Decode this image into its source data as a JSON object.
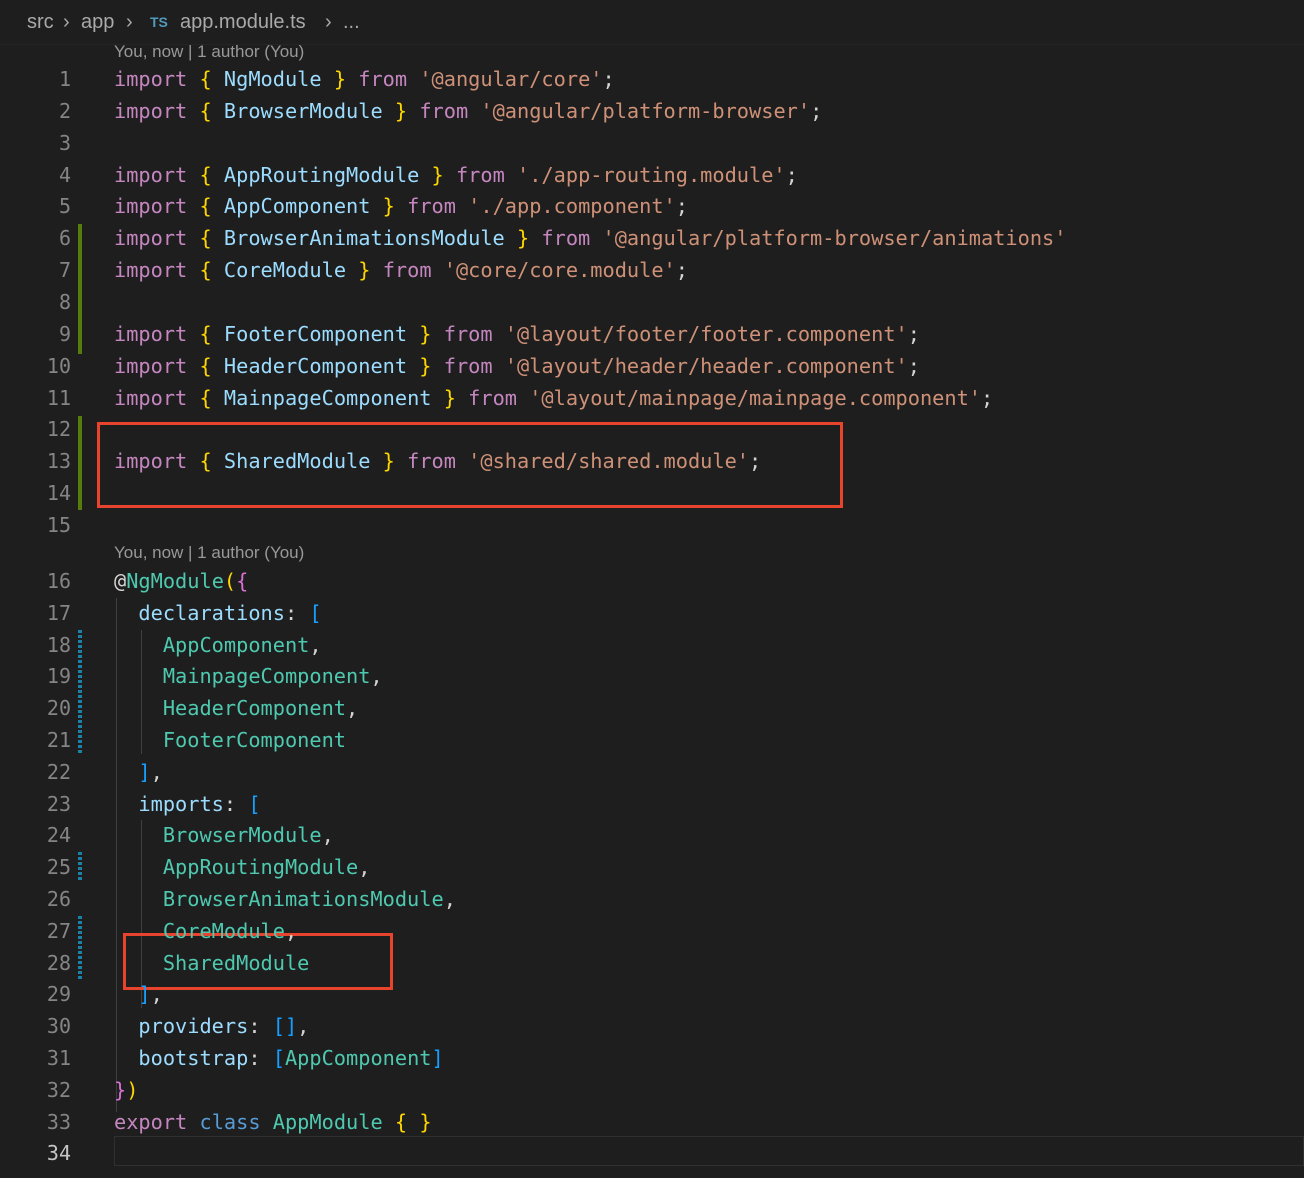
{
  "breadcrumb": {
    "items": [
      "src",
      "app"
    ],
    "file_icon": "TS",
    "file": "app.module.ts",
    "trailing": "..."
  },
  "codelens": {
    "first": "You, now | 1 author (You)",
    "second": "You, now | 1 author (You)"
  },
  "editor": {
    "current_line": 34,
    "lines": [
      {
        "n": 1,
        "tokens": [
          [
            "kw",
            "import"
          ],
          [
            "punc",
            " "
          ],
          [
            "br",
            "{"
          ],
          [
            "punc",
            " "
          ],
          [
            "id",
            "NgModule"
          ],
          [
            "punc",
            " "
          ],
          [
            "br",
            "}"
          ],
          [
            "punc",
            " "
          ],
          [
            "kw",
            "from"
          ],
          [
            "punc",
            " "
          ],
          [
            "str",
            "'@angular/core'"
          ],
          [
            "punc",
            ";"
          ]
        ]
      },
      {
        "n": 2,
        "tokens": [
          [
            "kw",
            "import"
          ],
          [
            "punc",
            " "
          ],
          [
            "br",
            "{"
          ],
          [
            "punc",
            " "
          ],
          [
            "id",
            "BrowserModule"
          ],
          [
            "punc",
            " "
          ],
          [
            "br",
            "}"
          ],
          [
            "punc",
            " "
          ],
          [
            "kw",
            "from"
          ],
          [
            "punc",
            " "
          ],
          [
            "str",
            "'@angular/platform-browser'"
          ],
          [
            "punc",
            ";"
          ]
        ]
      },
      {
        "n": 3,
        "tokens": []
      },
      {
        "n": 4,
        "tokens": [
          [
            "kw",
            "import"
          ],
          [
            "punc",
            " "
          ],
          [
            "br",
            "{"
          ],
          [
            "punc",
            " "
          ],
          [
            "id",
            "AppRoutingModule"
          ],
          [
            "punc",
            " "
          ],
          [
            "br",
            "}"
          ],
          [
            "punc",
            " "
          ],
          [
            "kw",
            "from"
          ],
          [
            "punc",
            " "
          ],
          [
            "str",
            "'./app-routing.module'"
          ],
          [
            "punc",
            ";"
          ]
        ]
      },
      {
        "n": 5,
        "tokens": [
          [
            "kw",
            "import"
          ],
          [
            "punc",
            " "
          ],
          [
            "br",
            "{"
          ],
          [
            "punc",
            " "
          ],
          [
            "id",
            "AppComponent"
          ],
          [
            "punc",
            " "
          ],
          [
            "br",
            "}"
          ],
          [
            "punc",
            " "
          ],
          [
            "kw",
            "from"
          ],
          [
            "punc",
            " "
          ],
          [
            "str",
            "'./app.component'"
          ],
          [
            "punc",
            ";"
          ]
        ]
      },
      {
        "n": 6,
        "tokens": [
          [
            "kw",
            "import"
          ],
          [
            "punc",
            " "
          ],
          [
            "br",
            "{"
          ],
          [
            "punc",
            " "
          ],
          [
            "id",
            "BrowserAnimationsModule"
          ],
          [
            "punc",
            " "
          ],
          [
            "br",
            "}"
          ],
          [
            "punc",
            " "
          ],
          [
            "kw",
            "from"
          ],
          [
            "punc",
            " "
          ],
          [
            "str",
            "'@angular/platform-browser/animations'"
          ]
        ]
      },
      {
        "n": 7,
        "tokens": [
          [
            "kw",
            "import"
          ],
          [
            "punc",
            " "
          ],
          [
            "br",
            "{"
          ],
          [
            "punc",
            " "
          ],
          [
            "id",
            "CoreModule"
          ],
          [
            "punc",
            " "
          ],
          [
            "br",
            "}"
          ],
          [
            "punc",
            " "
          ],
          [
            "kw",
            "from"
          ],
          [
            "punc",
            " "
          ],
          [
            "str",
            "'@core/core.module'"
          ],
          [
            "punc",
            ";"
          ]
        ]
      },
      {
        "n": 8,
        "tokens": []
      },
      {
        "n": 9,
        "tokens": [
          [
            "kw",
            "import"
          ],
          [
            "punc",
            " "
          ],
          [
            "br",
            "{"
          ],
          [
            "punc",
            " "
          ],
          [
            "id",
            "FooterComponent"
          ],
          [
            "punc",
            " "
          ],
          [
            "br",
            "}"
          ],
          [
            "punc",
            " "
          ],
          [
            "kw",
            "from"
          ],
          [
            "punc",
            " "
          ],
          [
            "str",
            "'@layout/footer/footer.component'"
          ],
          [
            "punc",
            ";"
          ]
        ]
      },
      {
        "n": 10,
        "tokens": [
          [
            "kw",
            "import"
          ],
          [
            "punc",
            " "
          ],
          [
            "br",
            "{"
          ],
          [
            "punc",
            " "
          ],
          [
            "id",
            "HeaderComponent"
          ],
          [
            "punc",
            " "
          ],
          [
            "br",
            "}"
          ],
          [
            "punc",
            " "
          ],
          [
            "kw",
            "from"
          ],
          [
            "punc",
            " "
          ],
          [
            "str",
            "'@layout/header/header.component'"
          ],
          [
            "punc",
            ";"
          ]
        ]
      },
      {
        "n": 11,
        "tokens": [
          [
            "kw",
            "import"
          ],
          [
            "punc",
            " "
          ],
          [
            "br",
            "{"
          ],
          [
            "punc",
            " "
          ],
          [
            "id",
            "MainpageComponent"
          ],
          [
            "punc",
            " "
          ],
          [
            "br",
            "}"
          ],
          [
            "punc",
            " "
          ],
          [
            "kw",
            "from"
          ],
          [
            "punc",
            " "
          ],
          [
            "str",
            "'@layout/mainpage/mainpage.component'"
          ],
          [
            "punc",
            ";"
          ]
        ]
      },
      {
        "n": 12,
        "tokens": []
      },
      {
        "n": 13,
        "tokens": [
          [
            "kw",
            "import"
          ],
          [
            "punc",
            " "
          ],
          [
            "br",
            "{"
          ],
          [
            "punc",
            " "
          ],
          [
            "id",
            "SharedModule"
          ],
          [
            "punc",
            " "
          ],
          [
            "br",
            "}"
          ],
          [
            "punc",
            " "
          ],
          [
            "kw",
            "from"
          ],
          [
            "punc",
            " "
          ],
          [
            "str",
            "'@shared/shared.module'"
          ],
          [
            "punc",
            ";"
          ]
        ]
      },
      {
        "n": 14,
        "tokens": []
      },
      {
        "n": 15,
        "tokens": []
      },
      {
        "n": 16,
        "tokens": [
          [
            "punc",
            "@"
          ],
          [
            "cls",
            "NgModule"
          ],
          [
            "br",
            "("
          ],
          [
            "br2",
            "{"
          ]
        ]
      },
      {
        "n": 17,
        "tokens": [
          [
            "punc",
            "  "
          ],
          [
            "id",
            "declarations"
          ],
          [
            "punc",
            ": "
          ],
          [
            "br3",
            "["
          ]
        ]
      },
      {
        "n": 18,
        "tokens": [
          [
            "punc",
            "    "
          ],
          [
            "cls",
            "AppComponent"
          ],
          [
            "punc",
            ","
          ]
        ]
      },
      {
        "n": 19,
        "tokens": [
          [
            "punc",
            "    "
          ],
          [
            "cls",
            "MainpageComponent"
          ],
          [
            "punc",
            ","
          ]
        ]
      },
      {
        "n": 20,
        "tokens": [
          [
            "punc",
            "    "
          ],
          [
            "cls",
            "HeaderComponent"
          ],
          [
            "punc",
            ","
          ]
        ]
      },
      {
        "n": 21,
        "tokens": [
          [
            "punc",
            "    "
          ],
          [
            "cls",
            "FooterComponent"
          ]
        ]
      },
      {
        "n": 22,
        "tokens": [
          [
            "punc",
            "  "
          ],
          [
            "br3",
            "]"
          ],
          [
            "punc",
            ","
          ]
        ]
      },
      {
        "n": 23,
        "tokens": [
          [
            "punc",
            "  "
          ],
          [
            "id",
            "imports"
          ],
          [
            "punc",
            ": "
          ],
          [
            "br3",
            "["
          ]
        ]
      },
      {
        "n": 24,
        "tokens": [
          [
            "punc",
            "    "
          ],
          [
            "cls",
            "BrowserModule"
          ],
          [
            "punc",
            ","
          ]
        ]
      },
      {
        "n": 25,
        "tokens": [
          [
            "punc",
            "    "
          ],
          [
            "cls",
            "AppRoutingModule"
          ],
          [
            "punc",
            ","
          ]
        ]
      },
      {
        "n": 26,
        "tokens": [
          [
            "punc",
            "    "
          ],
          [
            "cls",
            "BrowserAnimationsModule"
          ],
          [
            "punc",
            ","
          ]
        ]
      },
      {
        "n": 27,
        "tokens": [
          [
            "punc",
            "    "
          ],
          [
            "cls",
            "CoreModule"
          ],
          [
            "punc",
            ","
          ]
        ]
      },
      {
        "n": 28,
        "tokens": [
          [
            "punc",
            "    "
          ],
          [
            "cls",
            "SharedModule"
          ]
        ]
      },
      {
        "n": 29,
        "tokens": [
          [
            "punc",
            "  "
          ],
          [
            "br3",
            "]"
          ],
          [
            "punc",
            ","
          ]
        ]
      },
      {
        "n": 30,
        "tokens": [
          [
            "punc",
            "  "
          ],
          [
            "id",
            "providers"
          ],
          [
            "punc",
            ": "
          ],
          [
            "br3",
            "[]"
          ],
          [
            "punc",
            ","
          ]
        ]
      },
      {
        "n": 31,
        "tokens": [
          [
            "punc",
            "  "
          ],
          [
            "id",
            "bootstrap"
          ],
          [
            "punc",
            ": "
          ],
          [
            "br3",
            "["
          ],
          [
            "cls",
            "AppComponent"
          ],
          [
            "br3",
            "]"
          ]
        ]
      },
      {
        "n": 32,
        "tokens": [
          [
            "br2",
            "}"
          ],
          [
            "br",
            ")"
          ]
        ]
      },
      {
        "n": 33,
        "tokens": [
          [
            "kw",
            "export"
          ],
          [
            "punc",
            " "
          ],
          [
            "kw2",
            "class"
          ],
          [
            "punc",
            " "
          ],
          [
            "cls",
            "AppModule"
          ],
          [
            "punc",
            " "
          ],
          [
            "br",
            "{"
          ],
          [
            "punc",
            " "
          ],
          [
            "br",
            "}"
          ]
        ]
      },
      {
        "n": 34,
        "tokens": []
      }
    ]
  },
  "colors": {
    "background": "#1e1e1e",
    "keyword": "#c586c0",
    "string": "#ce9178",
    "identifier": "#9cdcfe",
    "class": "#4ec9b0",
    "highlight_box": "#e8432d",
    "git_added": "#587c0c",
    "git_modified": "#1b81a8"
  },
  "icons": [
    "chevron-right-icon",
    "typescript-file-icon"
  ]
}
